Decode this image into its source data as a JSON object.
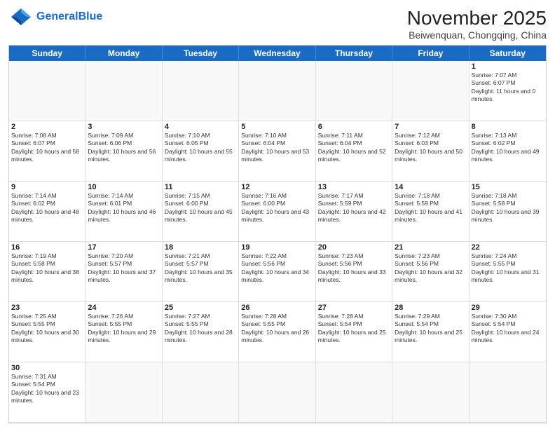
{
  "header": {
    "logo_general": "General",
    "logo_blue": "Blue",
    "month_title": "November 2025",
    "location": "Beiwenquan, Chongqing, China"
  },
  "days": [
    "Sunday",
    "Monday",
    "Tuesday",
    "Wednesday",
    "Thursday",
    "Friday",
    "Saturday"
  ],
  "cells": [
    {
      "day": null,
      "empty": true
    },
    {
      "day": null,
      "empty": true
    },
    {
      "day": null,
      "empty": true
    },
    {
      "day": null,
      "empty": true
    },
    {
      "day": null,
      "empty": true
    },
    {
      "day": null,
      "empty": true
    },
    {
      "day": "1",
      "sunrise": "7:07 AM",
      "sunset": "6:07 PM",
      "daylight": "11 hours and 0 minutes."
    },
    {
      "day": "2",
      "sunrise": "7:08 AM",
      "sunset": "6:07 PM",
      "daylight": "10 hours and 58 minutes."
    },
    {
      "day": "3",
      "sunrise": "7:09 AM",
      "sunset": "6:06 PM",
      "daylight": "10 hours and 56 minutes."
    },
    {
      "day": "4",
      "sunrise": "7:10 AM",
      "sunset": "6:05 PM",
      "daylight": "10 hours and 55 minutes."
    },
    {
      "day": "5",
      "sunrise": "7:10 AM",
      "sunset": "6:04 PM",
      "daylight": "10 hours and 53 minutes."
    },
    {
      "day": "6",
      "sunrise": "7:11 AM",
      "sunset": "6:04 PM",
      "daylight": "10 hours and 52 minutes."
    },
    {
      "day": "7",
      "sunrise": "7:12 AM",
      "sunset": "6:03 PM",
      "daylight": "10 hours and 50 minutes."
    },
    {
      "day": "8",
      "sunrise": "7:13 AM",
      "sunset": "6:02 PM",
      "daylight": "10 hours and 49 minutes."
    },
    {
      "day": "9",
      "sunrise": "7:14 AM",
      "sunset": "6:02 PM",
      "daylight": "10 hours and 48 minutes."
    },
    {
      "day": "10",
      "sunrise": "7:14 AM",
      "sunset": "6:01 PM",
      "daylight": "10 hours and 46 minutes."
    },
    {
      "day": "11",
      "sunrise": "7:15 AM",
      "sunset": "6:00 PM",
      "daylight": "10 hours and 45 minutes."
    },
    {
      "day": "12",
      "sunrise": "7:16 AM",
      "sunset": "6:00 PM",
      "daylight": "10 hours and 43 minutes."
    },
    {
      "day": "13",
      "sunrise": "7:17 AM",
      "sunset": "5:59 PM",
      "daylight": "10 hours and 42 minutes."
    },
    {
      "day": "14",
      "sunrise": "7:18 AM",
      "sunset": "5:59 PM",
      "daylight": "10 hours and 41 minutes."
    },
    {
      "day": "15",
      "sunrise": "7:18 AM",
      "sunset": "5:58 PM",
      "daylight": "10 hours and 39 minutes."
    },
    {
      "day": "16",
      "sunrise": "7:19 AM",
      "sunset": "5:58 PM",
      "daylight": "10 hours and 38 minutes."
    },
    {
      "day": "17",
      "sunrise": "7:20 AM",
      "sunset": "5:57 PM",
      "daylight": "10 hours and 37 minutes."
    },
    {
      "day": "18",
      "sunrise": "7:21 AM",
      "sunset": "5:57 PM",
      "daylight": "10 hours and 35 minutes."
    },
    {
      "day": "19",
      "sunrise": "7:22 AM",
      "sunset": "5:56 PM",
      "daylight": "10 hours and 34 minutes."
    },
    {
      "day": "20",
      "sunrise": "7:23 AM",
      "sunset": "5:56 PM",
      "daylight": "10 hours and 33 minutes."
    },
    {
      "day": "21",
      "sunrise": "7:23 AM",
      "sunset": "5:56 PM",
      "daylight": "10 hours and 32 minutes."
    },
    {
      "day": "22",
      "sunrise": "7:24 AM",
      "sunset": "5:55 PM",
      "daylight": "10 hours and 31 minutes."
    },
    {
      "day": "23",
      "sunrise": "7:25 AM",
      "sunset": "5:55 PM",
      "daylight": "10 hours and 30 minutes."
    },
    {
      "day": "24",
      "sunrise": "7:26 AM",
      "sunset": "5:55 PM",
      "daylight": "10 hours and 29 minutes."
    },
    {
      "day": "25",
      "sunrise": "7:27 AM",
      "sunset": "5:55 PM",
      "daylight": "10 hours and 28 minutes."
    },
    {
      "day": "26",
      "sunrise": "7:28 AM",
      "sunset": "5:55 PM",
      "daylight": "10 hours and 26 minutes."
    },
    {
      "day": "27",
      "sunrise": "7:28 AM",
      "sunset": "5:54 PM",
      "daylight": "10 hours and 25 minutes."
    },
    {
      "day": "28",
      "sunrise": "7:29 AM",
      "sunset": "5:54 PM",
      "daylight": "10 hours and 25 minutes."
    },
    {
      "day": "29",
      "sunrise": "7:30 AM",
      "sunset": "5:54 PM",
      "daylight": "10 hours and 24 minutes."
    },
    {
      "day": "30",
      "sunrise": "7:31 AM",
      "sunset": "5:54 PM",
      "daylight": "10 hours and 23 minutes."
    },
    {
      "day": null,
      "empty": true
    },
    {
      "day": null,
      "empty": true
    },
    {
      "day": null,
      "empty": true
    },
    {
      "day": null,
      "empty": true
    },
    {
      "day": null,
      "empty": true
    },
    {
      "day": null,
      "empty": true
    }
  ]
}
